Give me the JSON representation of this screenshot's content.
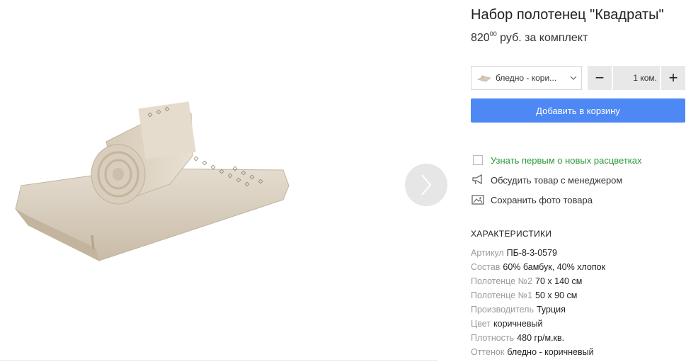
{
  "product": {
    "title": "Набор полотенец \"Квадраты\"",
    "price_main": "820",
    "price_cents": "00",
    "price_suffix": " руб. за комплект"
  },
  "variant": {
    "label": "бледно - кори...",
    "thumb_icon": "towel-thumbnail-icon",
    "chevron_icon": "chevron-down-icon"
  },
  "quantity": {
    "minus": "−",
    "value": "1 ком.",
    "plus": "+"
  },
  "cart": {
    "add_label": "Добавить в корзину",
    "color": "#4e88f5"
  },
  "actions": {
    "notify": "Узнать первым о новых расцветках",
    "discuss": "Обсудить товар с менеджером",
    "save_photo": "Сохранить фото товара"
  },
  "specs": {
    "heading": "ХАРАКТЕРИСТИКИ",
    "rows": [
      {
        "key": "Артикул",
        "value": "ПБ-8-3-0579"
      },
      {
        "key": "Состав",
        "value": "60% бамбук, 40% хлопок"
      },
      {
        "key": "Полотенце №2",
        "value": "70 х 140 см"
      },
      {
        "key": "Полотенце №1",
        "value": "50 х 90 см"
      },
      {
        "key": "Производитель",
        "value": "Турция"
      },
      {
        "key": "Цвет",
        "value": "коричневый"
      },
      {
        "key": "Плотность",
        "value": "480 гр/м.кв."
      },
      {
        "key": "Оттенок",
        "value": "бледно - коричневый"
      }
    ]
  },
  "colors": {
    "accent_green": "#2b9a3a",
    "towel": "#ddd2c2"
  }
}
